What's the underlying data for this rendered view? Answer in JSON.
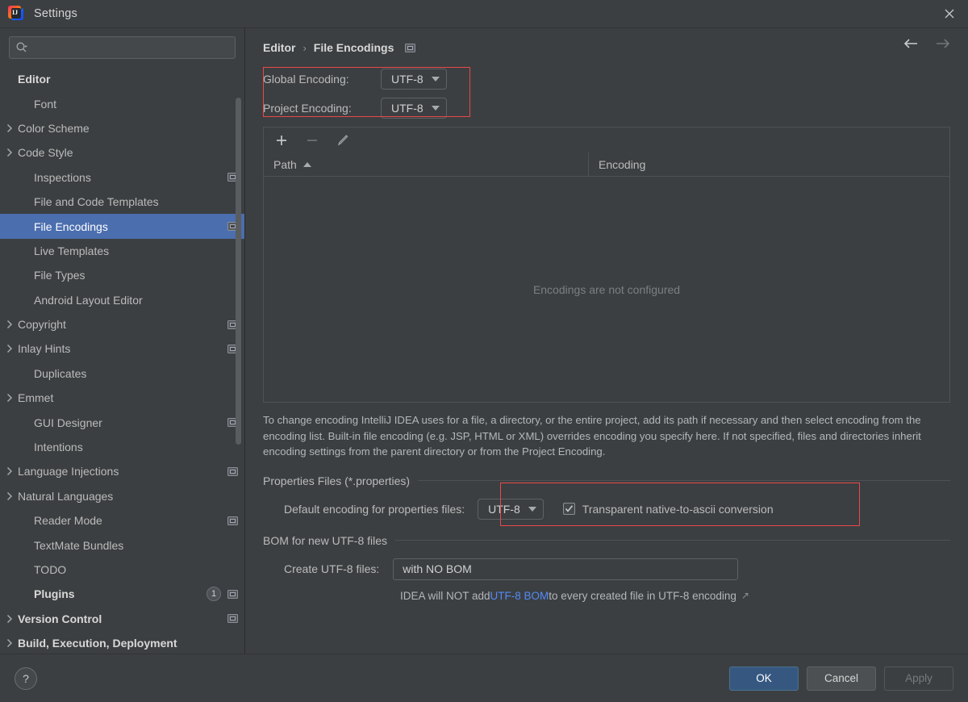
{
  "window": {
    "title": "Settings",
    "logo_icon": "intellij-idea-logo",
    "close_icon": "close-icon"
  },
  "sidebar": {
    "search": {
      "placeholder": "",
      "value": "",
      "icon": "search-icon"
    },
    "items": [
      {
        "label": "Editor",
        "depth": 0,
        "bold": true,
        "arrow": false,
        "cfg": false
      },
      {
        "label": "Font",
        "depth": 1,
        "bold": false,
        "arrow": false,
        "cfg": false
      },
      {
        "label": "Color Scheme",
        "depth": 0,
        "bold": false,
        "arrow": true,
        "cfg": false
      },
      {
        "label": "Code Style",
        "depth": 0,
        "bold": false,
        "arrow": true,
        "cfg": false
      },
      {
        "label": "Inspections",
        "depth": 1,
        "bold": false,
        "arrow": false,
        "cfg": true
      },
      {
        "label": "File and Code Templates",
        "depth": 1,
        "bold": false,
        "arrow": false,
        "cfg": false
      },
      {
        "label": "File Encodings",
        "depth": 1,
        "bold": false,
        "arrow": false,
        "cfg": true,
        "selected": true
      },
      {
        "label": "Live Templates",
        "depth": 1,
        "bold": false,
        "arrow": false,
        "cfg": false
      },
      {
        "label": "File Types",
        "depth": 1,
        "bold": false,
        "arrow": false,
        "cfg": false
      },
      {
        "label": "Android Layout Editor",
        "depth": 1,
        "bold": false,
        "arrow": false,
        "cfg": false
      },
      {
        "label": "Copyright",
        "depth": 0,
        "bold": false,
        "arrow": true,
        "cfg": true
      },
      {
        "label": "Inlay Hints",
        "depth": 0,
        "bold": false,
        "arrow": true,
        "cfg": true
      },
      {
        "label": "Duplicates",
        "depth": 1,
        "bold": false,
        "arrow": false,
        "cfg": false
      },
      {
        "label": "Emmet",
        "depth": 0,
        "bold": false,
        "arrow": true,
        "cfg": false
      },
      {
        "label": "GUI Designer",
        "depth": 1,
        "bold": false,
        "arrow": false,
        "cfg": true
      },
      {
        "label": "Intentions",
        "depth": 1,
        "bold": false,
        "arrow": false,
        "cfg": false
      },
      {
        "label": "Language Injections",
        "depth": 0,
        "bold": false,
        "arrow": true,
        "cfg": true
      },
      {
        "label": "Natural Languages",
        "depth": 0,
        "bold": false,
        "arrow": true,
        "cfg": false
      },
      {
        "label": "Reader Mode",
        "depth": 1,
        "bold": false,
        "arrow": false,
        "cfg": true
      },
      {
        "label": "TextMate Bundles",
        "depth": 1,
        "bold": false,
        "arrow": false,
        "cfg": false
      },
      {
        "label": "TODO",
        "depth": 1,
        "bold": false,
        "arrow": false,
        "cfg": false
      },
      {
        "label": "Plugins",
        "depth": 1,
        "bold": true,
        "arrow": false,
        "cfg": true,
        "badge": "1"
      },
      {
        "label": "Version Control",
        "depth": 0,
        "bold": true,
        "arrow": true,
        "cfg": true
      },
      {
        "label": "Build, Execution, Deployment",
        "depth": 0,
        "bold": true,
        "arrow": true,
        "cfg": false
      }
    ]
  },
  "breadcrumb": {
    "root": "Editor",
    "separator": "›",
    "current": "File Encodings",
    "config_icon": "settings-rect-icon",
    "back_icon": "arrow-left-icon",
    "forward_icon": "arrow-right-icon"
  },
  "encodings": {
    "global_label": "Global Encoding:",
    "global_value": "UTF-8",
    "project_label": "Project Encoding:",
    "project_value": "UTF-8",
    "highlight_color": "#e8484a"
  },
  "table": {
    "toolbar": {
      "add_icon": "plus-icon",
      "remove_icon": "minus-icon",
      "edit_icon": "pencil-icon"
    },
    "columns": [
      "Path",
      "Encoding"
    ],
    "sort_column": "Path",
    "sort_direction": "asc",
    "rows": [],
    "empty_message": "Encodings are not configured"
  },
  "description": "To change encoding IntelliJ IDEA uses for a file, a directory, or the entire project, add its path if necessary and then select encoding from the encoding list. Built-in file encoding (e.g. JSP, HTML or XML) overrides encoding you specify here. If not specified, files and directories inherit encoding settings from the parent directory or from the Project Encoding.",
  "properties_section": {
    "title": "Properties Files (*.properties)",
    "default_encoding_label": "Default encoding for properties files:",
    "default_encoding_value": "UTF-8",
    "checkbox_label": "Transparent native-to-ascii conversion",
    "checkbox_checked": true,
    "highlight_color": "#e8484a"
  },
  "bom_section": {
    "title": "BOM for new UTF-8 files",
    "create_label": "Create UTF-8 files:",
    "create_value": "with NO BOM",
    "hint_prefix": "IDEA will NOT add ",
    "hint_link": "UTF-8 BOM",
    "hint_suffix": " to every created file in UTF-8 encoding",
    "hint_link_color": "#548af7",
    "external_icon": "external-link-arrow-icon"
  },
  "footer": {
    "help_label": "?",
    "ok_label": "OK",
    "cancel_label": "Cancel",
    "apply_label": "Apply",
    "apply_disabled": true,
    "ok_color": "#365880"
  }
}
